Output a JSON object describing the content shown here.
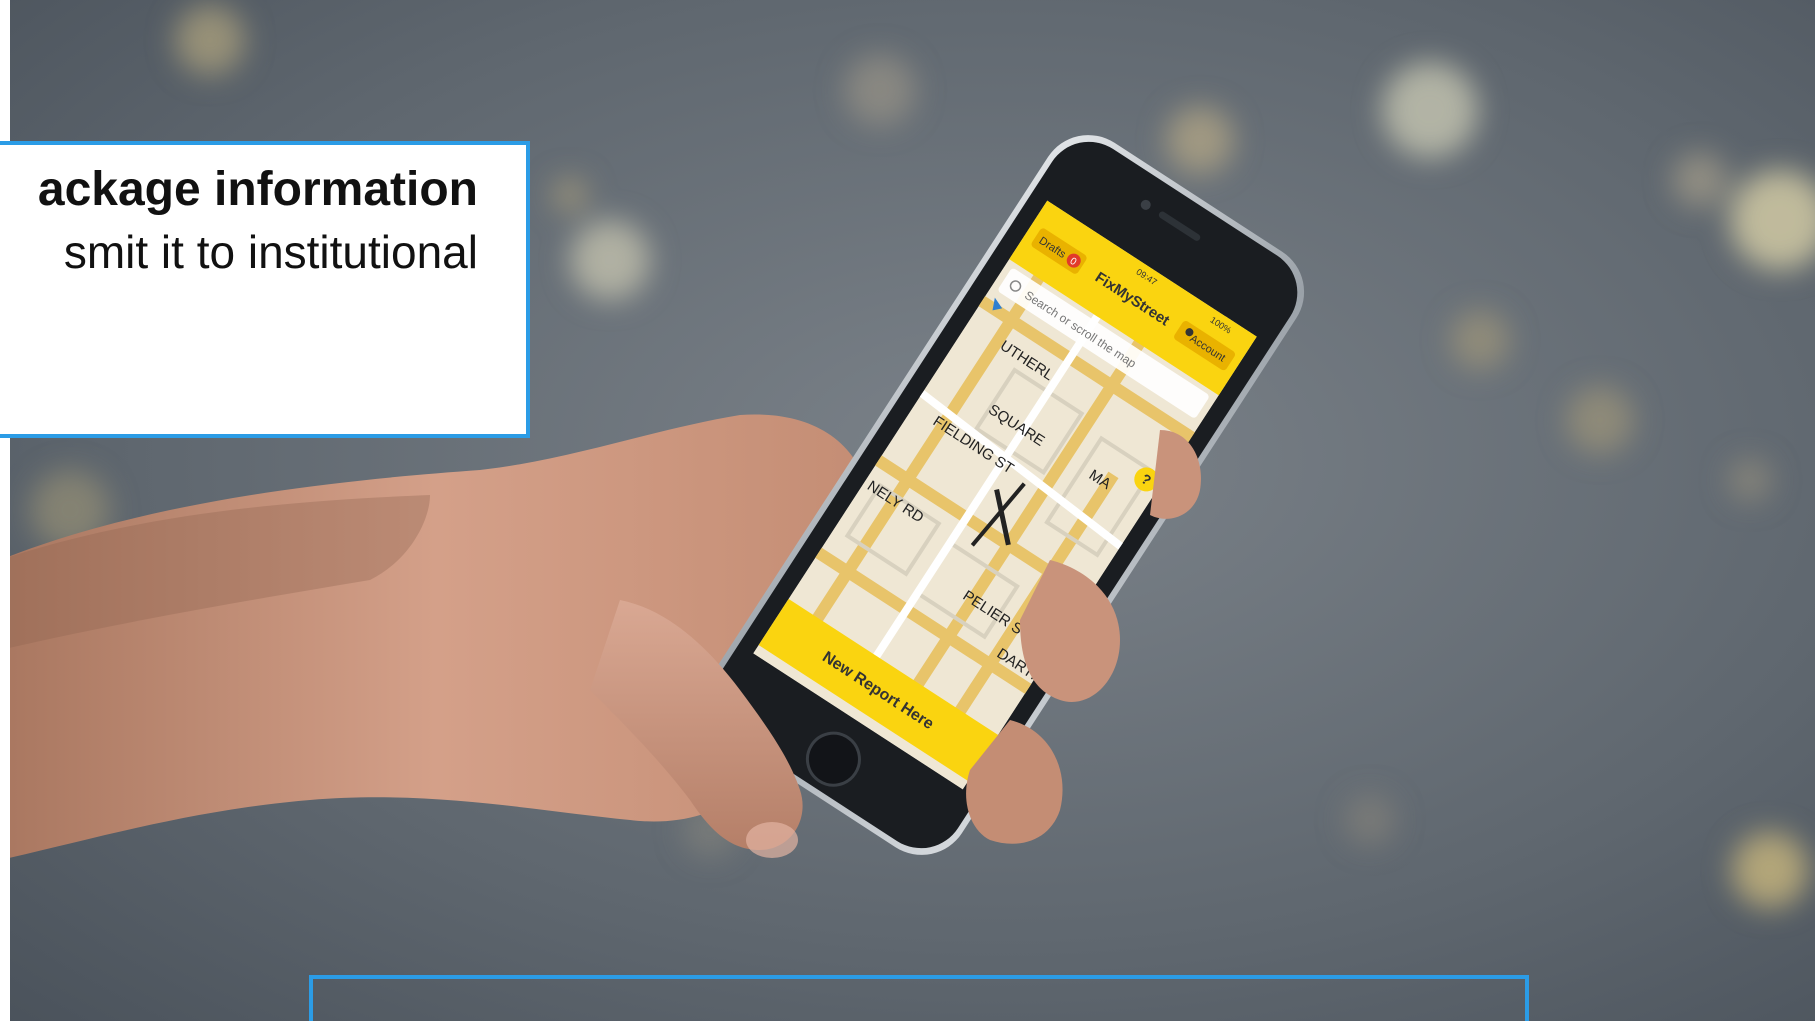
{
  "callout": {
    "heading": "ackage information",
    "body": "smit it to institutional"
  },
  "phone": {
    "status_time": "09:47",
    "battery": "100%",
    "app_title": "FixMyStreet",
    "drafts_label": "Drafts",
    "drafts_count": "0",
    "account_label": "Account",
    "search_placeholder": "Search or scroll the map",
    "help_label": "?",
    "cta_label": "New Report Here",
    "street_labels": [
      "UTHERL",
      "SQUARE",
      "FIELDING ST",
      "PELIER S",
      "DARTFORD",
      "NELY RD",
      "MA"
    ]
  },
  "colors": {
    "frame_border": "#2b9ce6",
    "app_yellow": "#fad410",
    "map_street": "#e8c46a",
    "map_bg": "#efe7d4"
  }
}
